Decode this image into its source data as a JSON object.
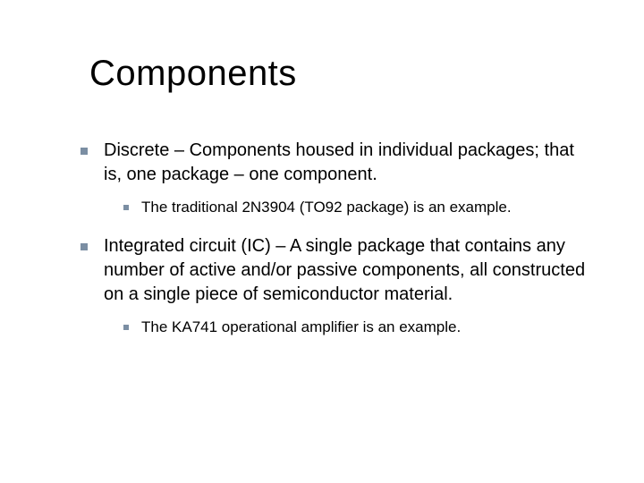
{
  "title": "Components",
  "items": [
    {
      "text": "Discrete – Components housed in individual packages; that is, one package – one component.",
      "sub": [
        {
          "text": "The traditional 2N3904 (TO92 package) is an example."
        }
      ]
    },
    {
      "text": "Integrated circuit (IC) – A single package that contains any number of active and/or passive components, all constructed on a single piece of semiconductor material.",
      "sub": [
        {
          "text": "The KA741 operational amplifier is an example."
        }
      ]
    }
  ]
}
